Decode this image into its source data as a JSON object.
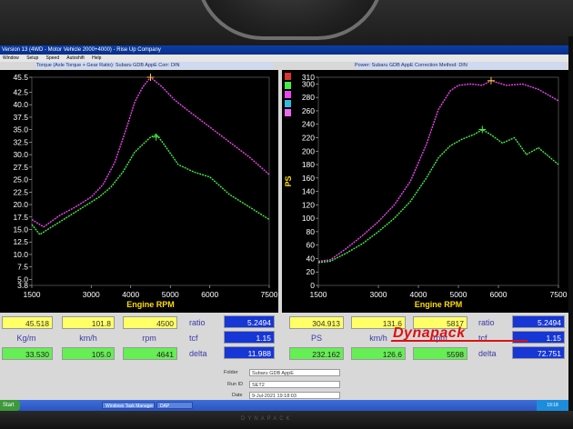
{
  "window": {
    "title": "Version 13 (4WD - Motor Vehicle 2000+4000) - Rise Up Company",
    "menu": [
      "Window",
      "Setup",
      "Speed",
      "Autoshift",
      "Help"
    ]
  },
  "left_chart": {
    "header": "Torque (Axle Torque + Gear Ratio): Subaru GDB AppE    Corr: DIN",
    "xlabel": "Engine RPM",
    "x_ticks": [
      "1500",
      "3000",
      "4000",
      "5000",
      "6000",
      "7500"
    ],
    "y_ticks": [
      "45.5",
      "42.5",
      "40.0",
      "37.5",
      "35.0",
      "32.5",
      "30.0",
      "27.5",
      "25.0",
      "22.5",
      "20.0",
      "17.5",
      "15.0",
      "12.5",
      "10.0",
      "7.5",
      "5.0",
      "3.8"
    ]
  },
  "right_chart": {
    "header": "Power: Subaru GDB AppE    Correction Method: DIN",
    "xlabel": "Engine RPM",
    "ylabel": "PS",
    "x_ticks": [
      "1500",
      "3000",
      "4000",
      "5000",
      "6000",
      "7500"
    ],
    "y_ticks": [
      "310",
      "300",
      "280",
      "260",
      "240",
      "220",
      "200",
      "180",
      "160",
      "140",
      "120",
      "100",
      "80",
      "60",
      "40",
      "20",
      "0"
    ]
  },
  "chart_data": [
    {
      "type": "line",
      "xlabel": "Engine RPM",
      "ylabel": "",
      "xlim": [
        1500,
        7500
      ],
      "ylim": [
        3.8,
        45.5
      ],
      "series": [
        {
          "color": "#ee44ee",
          "x": [
            1500,
            1800,
            2200,
            2600,
            3000,
            3300,
            3600,
            3900,
            4100,
            4300,
            4500,
            4800,
            5100,
            5500,
            6000,
            6500,
            7000,
            7500
          ],
          "values": [
            17.0,
            15.5,
            17.8,
            19.5,
            21.5,
            24.0,
            28.5,
            35.5,
            40.5,
            43.5,
            45.5,
            43.5,
            41.0,
            38.5,
            35.5,
            32.5,
            29.5,
            26.0
          ]
        },
        {
          "color": "#44ee44",
          "x": [
            1500,
            1700,
            2000,
            2400,
            2800,
            3200,
            3500,
            3800,
            4100,
            4300,
            4500,
            4650,
            4800,
            5200,
            5600,
            6000,
            6500,
            7000,
            7500
          ],
          "values": [
            16.0,
            14.0,
            15.5,
            17.5,
            19.5,
            21.5,
            23.5,
            26.5,
            30.5,
            32.0,
            33.5,
            34.0,
            32.5,
            28.0,
            26.5,
            25.5,
            22.0,
            19.5,
            17.0
          ]
        }
      ],
      "markers": [
        {
          "x": 4500,
          "y": 45.5,
          "color": "#ee44ee"
        },
        {
          "x": 4641,
          "y": 33.53,
          "color": "#44ee44"
        }
      ]
    },
    {
      "type": "line",
      "xlabel": "Engine RPM",
      "ylabel": "PS",
      "xlim": [
        1500,
        7500
      ],
      "ylim": [
        0,
        310
      ],
      "series": [
        {
          "color": "#ee44ee",
          "x": [
            1500,
            1800,
            2200,
            2600,
            3000,
            3400,
            3800,
            4200,
            4500,
            4800,
            5000,
            5300,
            5600,
            5817,
            6200,
            6600,
            7000,
            7500
          ],
          "values": [
            36,
            38,
            55,
            74,
            95,
            120,
            155,
            210,
            262,
            290,
            298,
            300,
            298,
            305,
            298,
            300,
            292,
            275
          ]
        },
        {
          "color": "#44ee44",
          "x": [
            1500,
            1800,
            2200,
            2600,
            3000,
            3400,
            3800,
            4200,
            4500,
            4800,
            5100,
            5400,
            5598,
            5800,
            6100,
            6400,
            6700,
            7000,
            7500
          ],
          "values": [
            34,
            36,
            48,
            62,
            80,
            100,
            125,
            160,
            190,
            208,
            218,
            225,
            232,
            225,
            212,
            220,
            195,
            205,
            180
          ]
        }
      ],
      "markers": [
        {
          "x": 5817,
          "y": 304.9,
          "color": "#ee44ee"
        },
        {
          "x": 5598,
          "y": 232.2,
          "color": "#44ee44"
        }
      ]
    }
  ],
  "left_readout": {
    "top_values": [
      "45.518",
      "101.8",
      "4500"
    ],
    "units": [
      "Kg/m",
      "km/h",
      "rpm"
    ],
    "bottom_values": [
      "33.530",
      "105.0",
      "4641"
    ],
    "labels": [
      "ratio",
      "tcf",
      "delta"
    ],
    "side_values": [
      "5.2494",
      "1.15",
      "11.988"
    ]
  },
  "right_readout": {
    "top_values": [
      "304.913",
      "131.6",
      "5817"
    ],
    "units": [
      "PS",
      "km/h",
      "rpm"
    ],
    "bottom_values": [
      "232.162",
      "126.6",
      "5598"
    ],
    "labels": [
      "ratio",
      "tcf",
      "delta"
    ],
    "side_values": [
      "5.2494",
      "1.15",
      "72.751"
    ]
  },
  "info": {
    "folder_label": "Folder",
    "folder_value": "Subaru GDB AppE",
    "run_label": "Run ID",
    "run_value": "SET2",
    "date_label": "Date",
    "date_value": "9-Jul-2021 19:18:03"
  },
  "logo": "Dynapack",
  "taskbar": {
    "start": "Start",
    "tasks": [
      "Windows Task Manager",
      "DAP"
    ],
    "clock": "19:18"
  },
  "bezel_text": "DYNAPACK",
  "colors": {
    "magenta": "#ee44ee",
    "green": "#44ee44",
    "blue": "#1636d6",
    "yellow": "#ffff66"
  }
}
